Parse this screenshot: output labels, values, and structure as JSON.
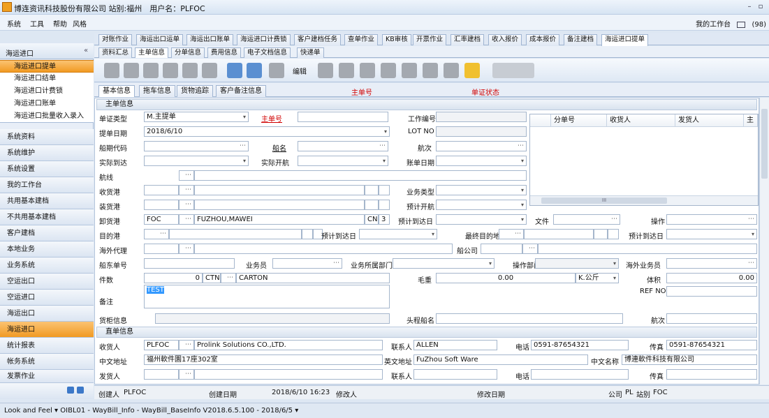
{
  "window": {
    "title": "博连资讯科技股份有限公司 站别:福州　用户名：PLFOC",
    "min": "–",
    "max": "▫"
  },
  "menu": [
    "系统",
    "工具",
    "帮助",
    "风格"
  ],
  "header_right": {
    "workbench": "我的工作台",
    "badge": "(98)"
  },
  "sidebar": {
    "header": "海运进口",
    "collapse": "«",
    "subitems": [
      "海运进口提单",
      "海运进口结单",
      "海运进口计费锁",
      "海运进口账单",
      "海运进口批量收入录入"
    ],
    "categories": [
      "系统资料",
      "系统维护",
      "系统设置",
      "我的工作台",
      "共用基本建档",
      "不共用基本建档",
      "客户建档",
      "本地业务",
      "业务系统",
      "空运出口",
      "空运进口",
      "海运出口",
      "海运进口",
      "统计报表",
      "帐务系统",
      "发票作业"
    ],
    "active_category": "海运进口"
  },
  "tabs1": [
    "对账作业",
    "海运出口运单",
    "海运出口账单",
    "海运进口计费锁",
    "客户建档任务",
    "查单作业",
    "KB审核",
    "开票作业",
    "汇率建档",
    "收入报价",
    "成本报价",
    "备注建档",
    "海运进口提单"
  ],
  "tabs2": [
    "资料汇总",
    "主单信息",
    "分单信息",
    "费用信息",
    "电子文档信息",
    "快递单"
  ],
  "toolbar": {
    "edit_label": "编辑"
  },
  "tabs3": [
    "基本信息",
    "拖车信息",
    "货物追踪",
    "客户备注信息"
  ],
  "tabs3_status": {
    "main_no": "主单号",
    "status": "单证状态"
  },
  "main_section": "主单信息",
  "form": {
    "doc_type_label": "单证类型",
    "doc_type": "M.主提单",
    "main_no_label": "主单号",
    "job_no_label": "工作编号",
    "bl_date_label": "提单日期",
    "bl_date": "2018/6/10",
    "lot_no_label": "LOT NO",
    "ship_code_label": "船期代码",
    "ship_name_label": "船名",
    "voyage_label": "航次",
    "actual_arrive_label": "实际到达",
    "actual_depart_label": "实际开航",
    "bill_date_label": "账单日期",
    "route_label": "航线",
    "receive_port_label": "收货港",
    "biz_type_label": "业务类型",
    "load_port_label": "装货港",
    "plan_depart_label": "预计开航",
    "discharge_port_label": "卸货港",
    "discharge_code": "FOC",
    "discharge_name": "FUZHOU,MAWEI",
    "country": "CN",
    "country_no": "3",
    "eta_label": "预计到达日",
    "file_label": "文件",
    "operate_label": "操作",
    "dest_port_label": "目的港",
    "dest_eta_label": "预计到达日",
    "final_dest_label": "最终目的地",
    "final_eta_label": "预计到达日",
    "overseas_agent_label": "海外代理",
    "carrier_label": "船公司",
    "ship_east_no_label": "船东单号",
    "sales_label": "业务员",
    "sales_dept_label": "业务所属部门",
    "op_dept_label": "操作部门",
    "overseas_sales_label": "海外业务员",
    "pieces_label": "件数",
    "pieces": "0",
    "pkg_code": "CTN",
    "pkg_name": "CARTON",
    "gross_label": "毛重",
    "gross": "0.00",
    "weight_unit": "K.公斤",
    "volume_label": "体积",
    "volume": "0.00",
    "remark_label": "备注",
    "remark": "TEST",
    "ref_no_label": "REF NO",
    "container_label": "货柜信息",
    "first_vessel_label": "头程船名",
    "first_voyage_label": "航次"
  },
  "grid": {
    "headers": [
      "分单号",
      "收货人",
      "发货人",
      "主"
    ],
    "scroll_mark": "III"
  },
  "consignee_section": "直单信息",
  "consignee": {
    "receiver_label": "收货人",
    "receiver_code": "PLFOC",
    "receiver_name": "Prolink Solutions CO.,LTD.",
    "contact_label": "联系人",
    "contact": "ALLEN",
    "phone_label": "电话",
    "phone": "0591-87654321",
    "fax_label": "传真",
    "fax": "0591-87654321",
    "cn_addr_label": "中文地址",
    "cn_addr": "福州軟件園17座302室",
    "en_addr_label": "英文地址",
    "en_addr": "FuZhou Soft Ware",
    "cn_name_label": "中文名称",
    "cn_name": "博連軟件科技有限公司",
    "shipper_label": "发货人",
    "contact2_label": "联系人",
    "phone2_label": "电话",
    "fax2_label": "传真"
  },
  "footer": {
    "creator_label": "创建人",
    "creator": "PLFOC",
    "create_date_label": "创建日期",
    "create_date": "2018/6/10 16:23",
    "modifier_label": "修改人",
    "modify_date_label": "修改日期",
    "company_label": "公司",
    "company": "PL",
    "station_label": "站别",
    "station": "FOC"
  },
  "status": "Look and Feel ▾  OIBL01 - WayBill_Info - WayBill_BaseInfo  V2018.6.5.100 - 2018/6/5 ▾"
}
